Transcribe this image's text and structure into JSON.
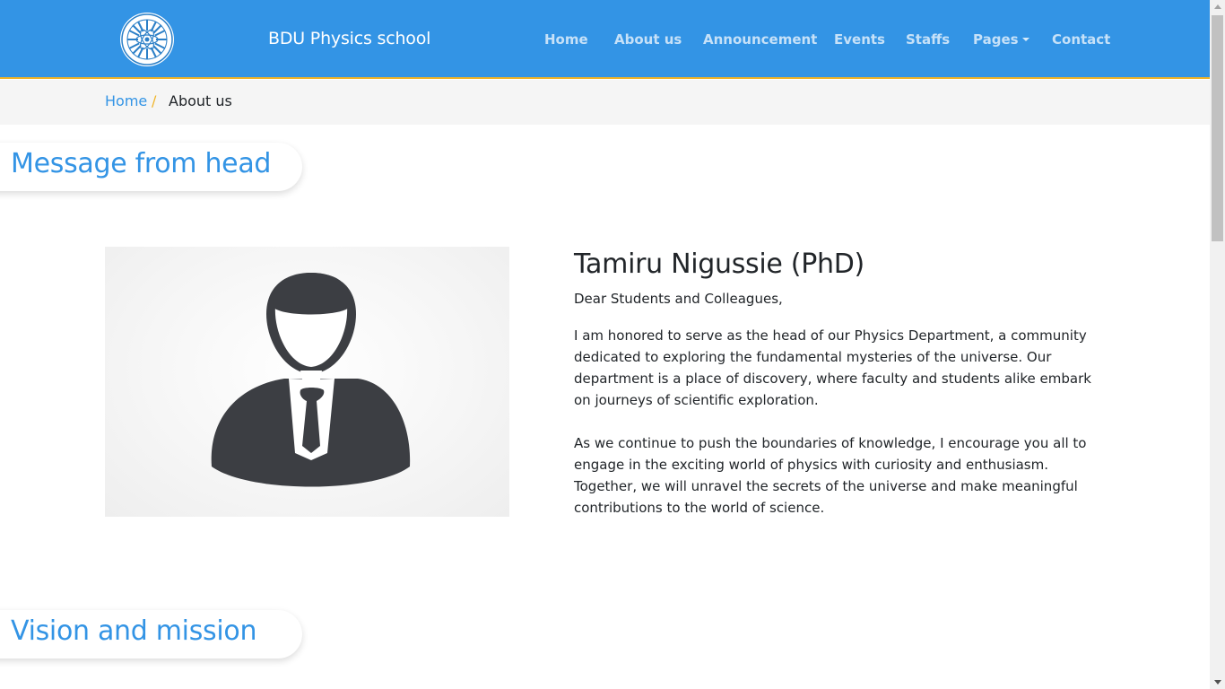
{
  "navbar": {
    "brand": "BDU Physics school",
    "logo_icon": "bdu-atom-logo",
    "items": [
      {
        "label": "Home"
      },
      {
        "label": "About us"
      },
      {
        "label": "Announcement"
      },
      {
        "label": "Events"
      },
      {
        "label": "Staffs"
      },
      {
        "label": "Pages",
        "dropdown": true
      },
      {
        "label": "Contact"
      }
    ],
    "colors": {
      "background": "#3394e5",
      "accent_border": "#f0b429"
    }
  },
  "breadcrumb": {
    "home": "Home",
    "separator": "/",
    "current": "About us"
  },
  "sections": {
    "message_title": "Message from head",
    "vision_title": "Vision and mission"
  },
  "head": {
    "photo_icon": "person-avatar-icon",
    "name": "Tamiru Nigussie (PhD)",
    "greeting": "Dear Students and Colleagues,",
    "paragraph1": "I am honored to serve as the head of our Physics Department, a community dedicated to exploring the fundamental mysteries of the universe. Our department is a place of discovery, where faculty and students alike embark on journeys of scientific exploration.",
    "paragraph2": "As we continue to push the boundaries of knowledge, I encourage you all to engage in the exciting world of physics with curiosity and enthusiasm. Together, we will unravel the secrets of the universe and make meaningful contributions to the world of science."
  },
  "colors": {
    "accent": "#3394e5",
    "text": "#212529"
  }
}
